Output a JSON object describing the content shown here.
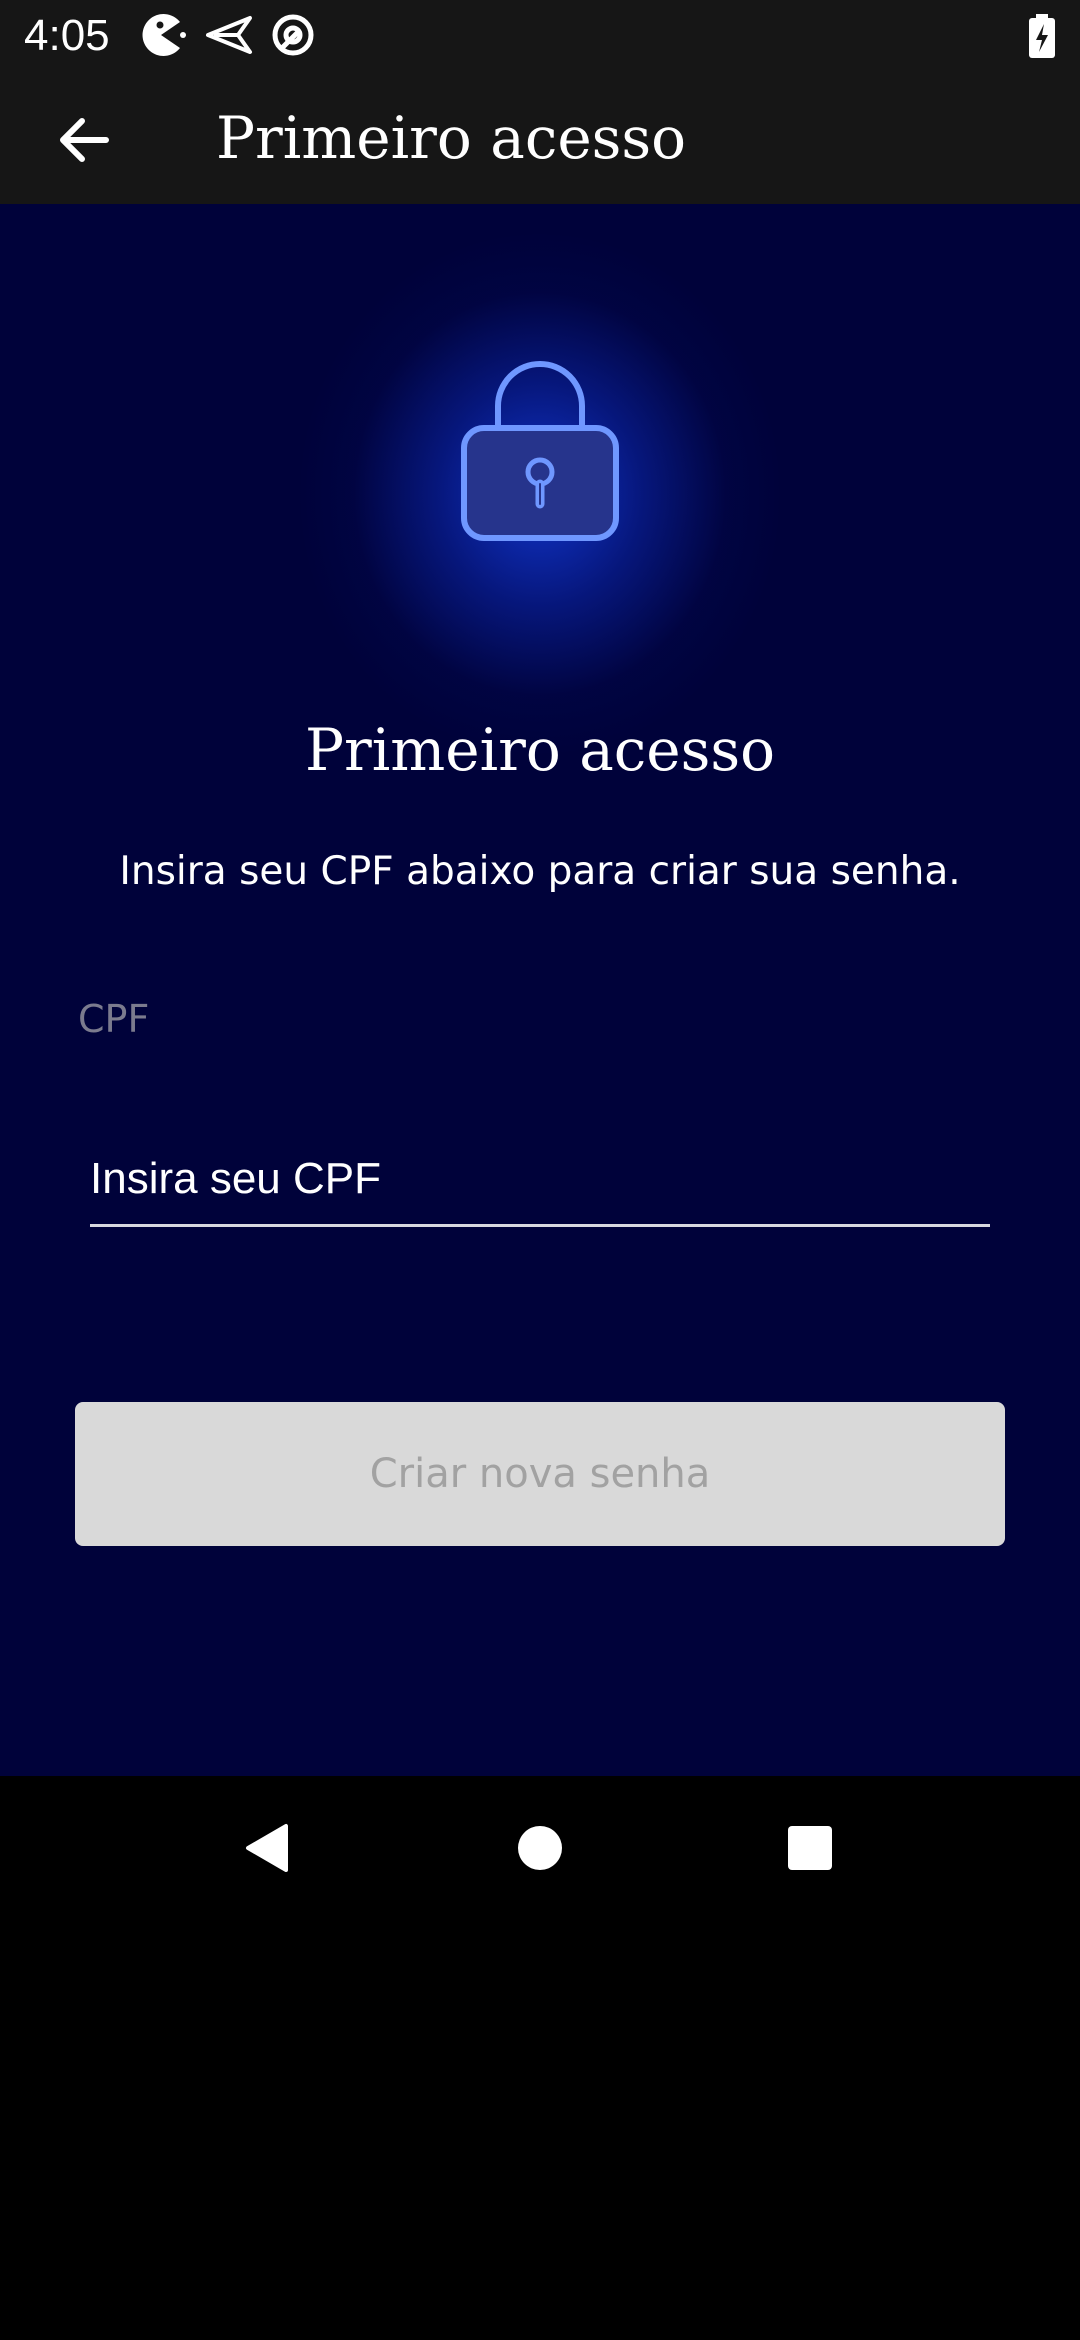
{
  "status_bar": {
    "time": "4:05",
    "icons": [
      "pacman-notification-icon",
      "send-notification-icon",
      "at-sign-notification-icon",
      "battery-charging-icon"
    ]
  },
  "app_bar": {
    "title": "Primeiro acesso",
    "back_icon": "arrow-left-icon"
  },
  "main": {
    "hero_icon": "lock-icon",
    "title": "Primeiro acesso",
    "subtitle": "Insira seu CPF abaixo para criar sua senha.",
    "cpf_label": "CPF",
    "cpf_input": {
      "placeholder": "Insira seu CPF",
      "value": ""
    },
    "submit_button": "Criar nova senha"
  },
  "nav_bar": {
    "back": "triangle-back-icon",
    "home": "circle-home-icon",
    "recents": "square-recents-icon"
  },
  "colors": {
    "background": "#00023a",
    "app_bar": "#161616",
    "accent": "#6f97ff",
    "button_disabled_bg": "#d9d9d9",
    "button_disabled_text": "#a2a2a2"
  }
}
